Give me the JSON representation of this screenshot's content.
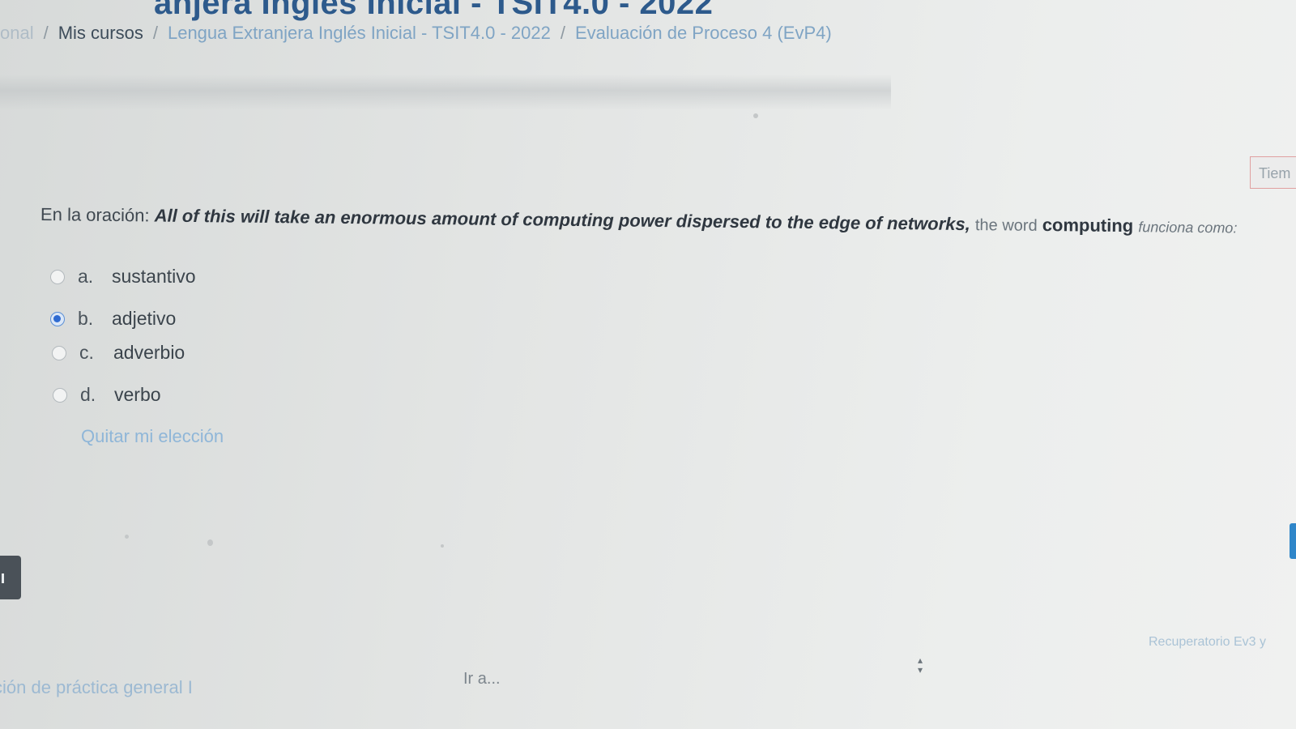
{
  "header": {
    "course_title": "anjera Inglés Inicial - TSIT4.0 - 2022"
  },
  "breadcrumb": {
    "first": "onal",
    "separator": "/",
    "my_courses": "Mis cursos",
    "course": "Lengua Extranjera Inglés Inicial - TSIT4.0 - 2022",
    "activity": "Evaluación de Proceso 4 (EvP4)"
  },
  "timer": {
    "label": "Tiem"
  },
  "question": {
    "prefix": "En la oración:",
    "sentence": "All of this will take an enormous amount of computing power dispersed to the edge of networks,",
    "middle": "the word",
    "word": "computing",
    "suffix": "funciona como:"
  },
  "options": [
    {
      "letter": "a.",
      "text": "sustantivo",
      "selected": false
    },
    {
      "letter": "b.",
      "text": "adjetivo",
      "selected": true
    },
    {
      "letter": "c.",
      "text": "adverbio",
      "selected": false
    },
    {
      "letter": "d.",
      "text": "verbo",
      "selected": false
    }
  ],
  "clear_choice": "Quitar mi elección",
  "navigation": {
    "previous_activity": "ción de práctica general I",
    "jump_to": "Ir a...",
    "next_activity": "Recuperatorio Ev3 y"
  },
  "colors": {
    "title": "#2d5a8c",
    "link": "#7fa4c4",
    "radio_selected": "#2f6bd1",
    "timer_border": "#e0a0a0"
  }
}
